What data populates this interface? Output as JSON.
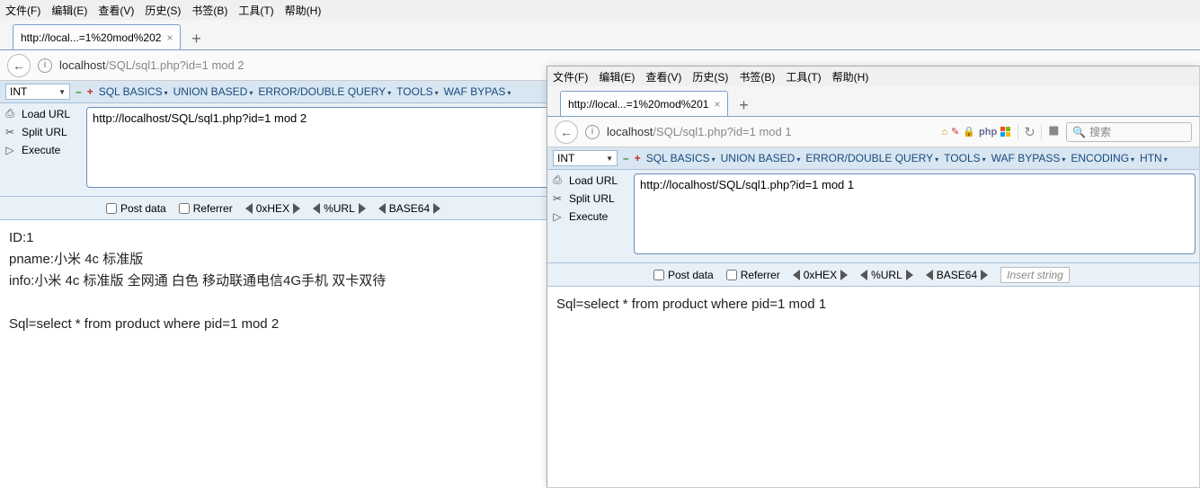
{
  "w1": {
    "menubar": [
      "文件(F)",
      "编辑(E)",
      "查看(V)",
      "历史(S)",
      "书签(B)",
      "工具(T)",
      "帮助(H)"
    ],
    "tab_title": "http://local...=1%20mod%202",
    "url_host": "localhost",
    "url_path": "/SQL/sql1.php?id=1 mod 2",
    "toolbar": {
      "int": "INT",
      "menus": [
        "SQL BASICS",
        "UNION BASED",
        "ERROR/DOUBLE QUERY",
        "TOOLS",
        "WAF BYPAS"
      ]
    },
    "side": {
      "load": "Load URL",
      "split": "Split URL",
      "exec": "Execute"
    },
    "url_box": "http://localhost/SQL/sql1.php?id=1 mod 2",
    "opts": {
      "post": "Post data",
      "ref": "Referrer",
      "hex": "0xHEX",
      "url": "%URL",
      "b64": "BASE64"
    },
    "content": {
      "l1": "ID:1",
      "l2": "pname:小米 4c 标准版",
      "l3": "info:小米 4c 标准版 全网通 白色 移动联通电信4G手机 双卡双待",
      "l4": "Sql=select * from product where pid=1 mod 2"
    }
  },
  "w2": {
    "menubar": [
      "文件(F)",
      "编辑(E)",
      "查看(V)",
      "历史(S)",
      "书签(B)",
      "工具(T)",
      "帮助(H)"
    ],
    "tab_title": "http://local...=1%20mod%201",
    "url_host": "localhost",
    "url_path": "/SQL/sql1.php?id=1 mod 1",
    "search_ph": "搜索",
    "toolbar": {
      "int": "INT",
      "menus": [
        "SQL BASICS",
        "UNION BASED",
        "ERROR/DOUBLE QUERY",
        "TOOLS",
        "WAF BYPASS",
        "ENCODING",
        "HTN"
      ]
    },
    "side": {
      "load": "Load URL",
      "split": "Split URL",
      "exec": "Execute"
    },
    "url_box": "http://localhost/SQL/sql1.php?id=1 mod 1",
    "opts": {
      "post": "Post data",
      "ref": "Referrer",
      "hex": "0xHEX",
      "url": "%URL",
      "b64": "BASE64",
      "insert": "Insert string"
    },
    "content": {
      "l1": "Sql=select * from product where pid=1 mod 1"
    }
  }
}
